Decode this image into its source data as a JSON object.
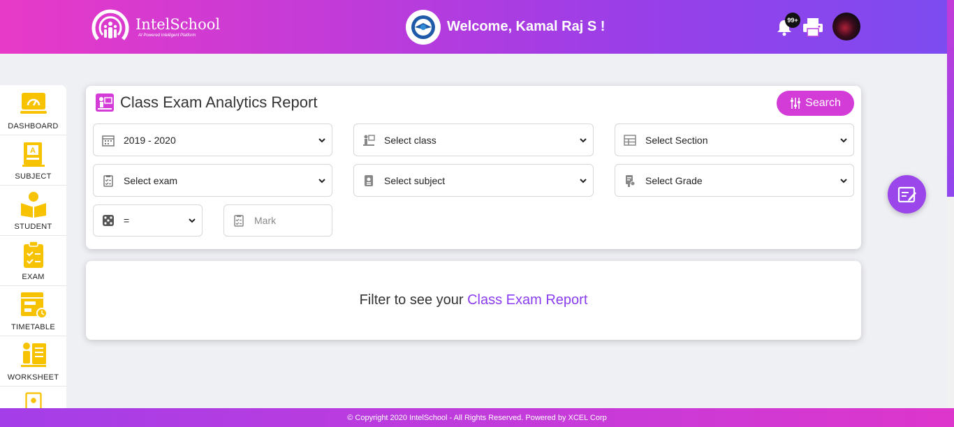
{
  "header": {
    "logo_name": "IntelSchool",
    "logo_tagline": "AI Powered Intelligent Platform",
    "welcome": "Welcome, Kamal Raj S !",
    "notification_count": "99+"
  },
  "sidebar": {
    "items": [
      {
        "label": "DASHBOARD",
        "icon": "dashboard-icon"
      },
      {
        "label": "SUBJECT",
        "icon": "subject-icon"
      },
      {
        "label": "STUDENT",
        "icon": "student-icon"
      },
      {
        "label": "EXAM",
        "icon": "exam-icon"
      },
      {
        "label": "TIMETABLE",
        "icon": "timetable-icon"
      },
      {
        "label": "WORKSHEET",
        "icon": "worksheet-icon"
      }
    ]
  },
  "filter": {
    "title": "Class Exam Analytics Report",
    "search_label": "Search",
    "year": "2019 - 2020",
    "class": "Select class",
    "section": "Select Section",
    "exam": "Select exam",
    "subject": "Select subject",
    "grade": "Select Grade",
    "operator": "=",
    "mark_placeholder": "Mark"
  },
  "result": {
    "prefix": "Filter to see your",
    "highlight": "Class Exam Report"
  },
  "footer": {
    "text": "© Copyright 2020 IntelSchool - All Rights Reserved. Powered by XCEL Corp"
  },
  "colors": {
    "accent": "#d33cd6",
    "highlight": "#8a3cf0",
    "icon_yellow": "#f7c200"
  }
}
